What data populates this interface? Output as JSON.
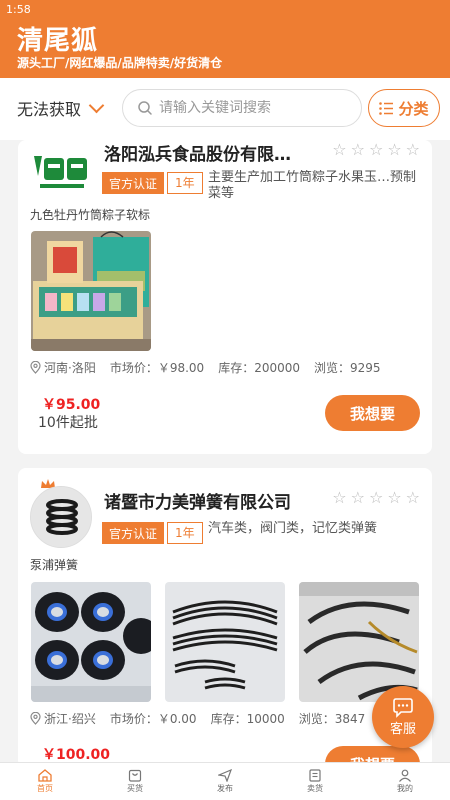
{
  "status": {
    "time": "1:58"
  },
  "header": {
    "brand": "清尾狐",
    "slogan": "源头工厂/网红爆品/品牌特卖/好货清仓"
  },
  "searchrow": {
    "location": "无法获取",
    "search_placeholder": "请输入关键词搜索",
    "category_label": "分类"
  },
  "cards": [
    {
      "company": "洛阳泓兵食品股份有限…",
      "cert_label": "官方认证",
      "year_label": "1年",
      "desc": "主要生产加工竹筒粽子水果玉…预制菜等",
      "product_name": "九色牡丹竹筒粽子软标",
      "location": "河南·洛阳",
      "market_price": "市场价：￥98.00",
      "stock": "库存：200000",
      "views": "浏览：9295",
      "price": "￥95.00",
      "moq": "10件起批",
      "action": "我想要",
      "rating": 0
    },
    {
      "company": "诸暨市力美弹簧有限公司",
      "cert_label": "官方认证",
      "year_label": "1年",
      "desc": "汽车类，阀门类，记忆类弹簧",
      "product_name": "泵浦弹簧",
      "location": "浙江·绍兴",
      "market_price": "市场价：￥0.00",
      "stock": "库存：10000",
      "views": "浏览：3847",
      "price": "￥100.00",
      "action": "我想要",
      "rating": 0
    }
  ],
  "service": {
    "label": "客服"
  },
  "tabs": [
    {
      "label": "首页",
      "icon": "home-icon",
      "active": true
    },
    {
      "label": "买货",
      "icon": "bag-icon"
    },
    {
      "label": "发布",
      "icon": "send-icon"
    },
    {
      "label": "卖货",
      "icon": "doc-icon"
    },
    {
      "label": "我的",
      "icon": "user-icon"
    }
  ],
  "colors": {
    "accent": "#ee7d32",
    "price": "#ee2222"
  }
}
